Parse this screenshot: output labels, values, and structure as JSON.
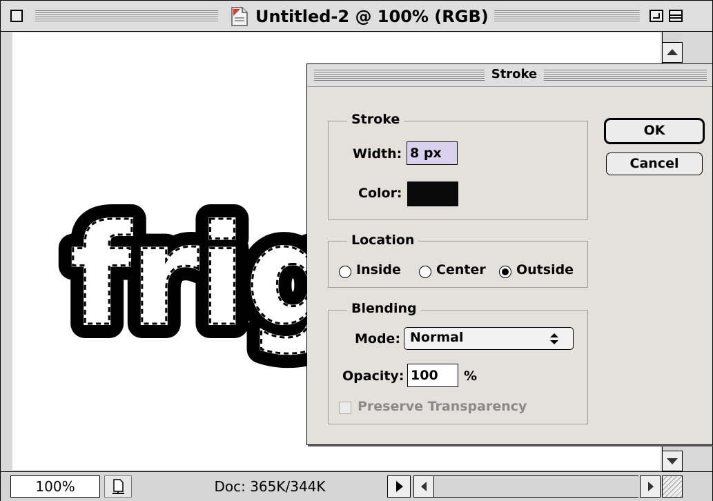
{
  "window": {
    "title": "Untitled-2 @ 100% (RGB)"
  },
  "canvas": {
    "artwork_text": "fright"
  },
  "status_bar": {
    "zoom": "100%",
    "doc_info": "Doc: 365K/344K"
  },
  "dialog": {
    "title": "Stroke",
    "stroke_group": {
      "label": "Stroke",
      "width_label": "Width:",
      "width_value": "8 px",
      "color_label": "Color:",
      "color_value": "#0a0a0a"
    },
    "location_group": {
      "label": "Location",
      "options": [
        "Inside",
        "Center",
        "Outside"
      ],
      "selected": "Outside"
    },
    "blending_group": {
      "label": "Blending",
      "mode_label": "Mode:",
      "mode_value": "Normal",
      "opacity_label": "Opacity:",
      "opacity_value": "100",
      "opacity_unit": "%",
      "preserve_label": "Preserve Transparency",
      "preserve_checked": false,
      "preserve_enabled": false
    },
    "buttons": {
      "ok": "OK",
      "cancel": "Cancel"
    }
  },
  "colors": {
    "dialog_bg": "#e4e1dd",
    "width_field_highlight": "#d8d2ee",
    "disabled_text": "#8a8a8a"
  }
}
